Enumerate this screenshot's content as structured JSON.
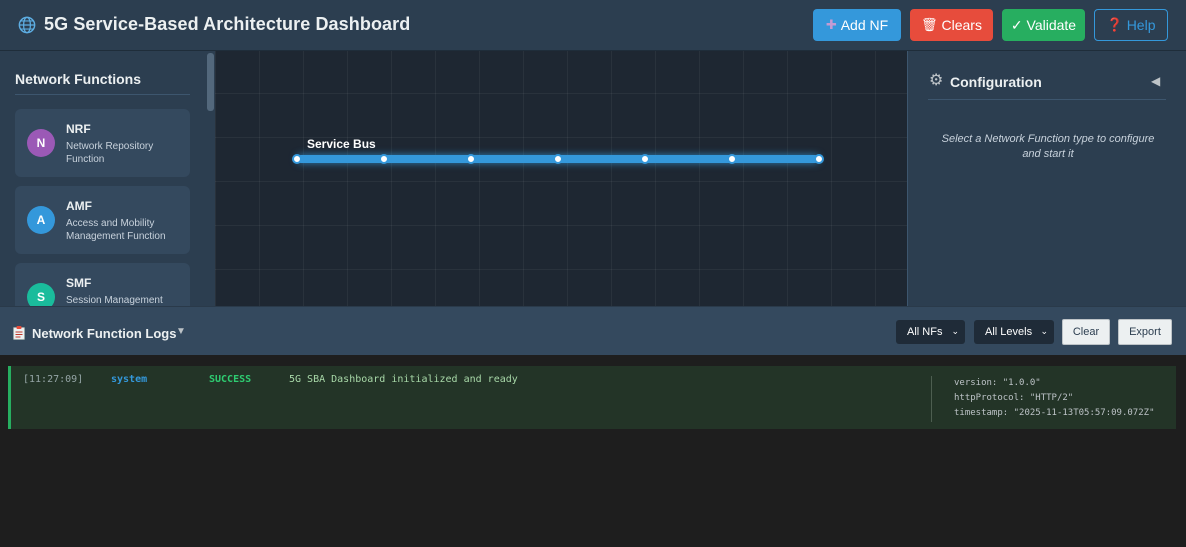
{
  "header": {
    "title": "5G Service-Based Architecture Dashboard",
    "buttons": {
      "add": "Add NF",
      "clear": "Clears",
      "validate": "✓ Validate",
      "help": "Help"
    }
  },
  "sidebar": {
    "title": "Network Functions",
    "items": [
      {
        "badge": "N",
        "name": "NRF",
        "description": "Network Repository Function",
        "color": "#9b59b6"
      },
      {
        "badge": "A",
        "name": "AMF",
        "description": "Access and Mobility Management Function",
        "color": "#3498db"
      },
      {
        "badge": "S",
        "name": "SMF",
        "description": "Session Management",
        "color": "#1abc9c"
      }
    ]
  },
  "canvas": {
    "bus_label": "Service Bus"
  },
  "config": {
    "title": "Configuration",
    "collapse": "◀",
    "hint": "Select a Network Function type to configure and start it"
  },
  "logs": {
    "title": "Network Function Logs",
    "toggle": "▼",
    "filter_nf": "All NFs",
    "filter_level": "All Levels",
    "clear_label": "Clear",
    "export_label": "Export",
    "entries": [
      {
        "timestamp": "[11:27:09]",
        "source": "system",
        "level": "SUCCESS",
        "message": "5G SBA Dashboard initialized and ready",
        "meta": [
          "version: \"1.0.0\"",
          "httpProtocol: \"HTTP/2\"",
          "timestamp: \"2025-11-13T05:57:09.072Z\""
        ]
      }
    ]
  },
  "colors": {
    "accent": "#3498db",
    "danger": "#e74c3c",
    "success": "#27ae60",
    "header_bg": "#2c3e50"
  }
}
